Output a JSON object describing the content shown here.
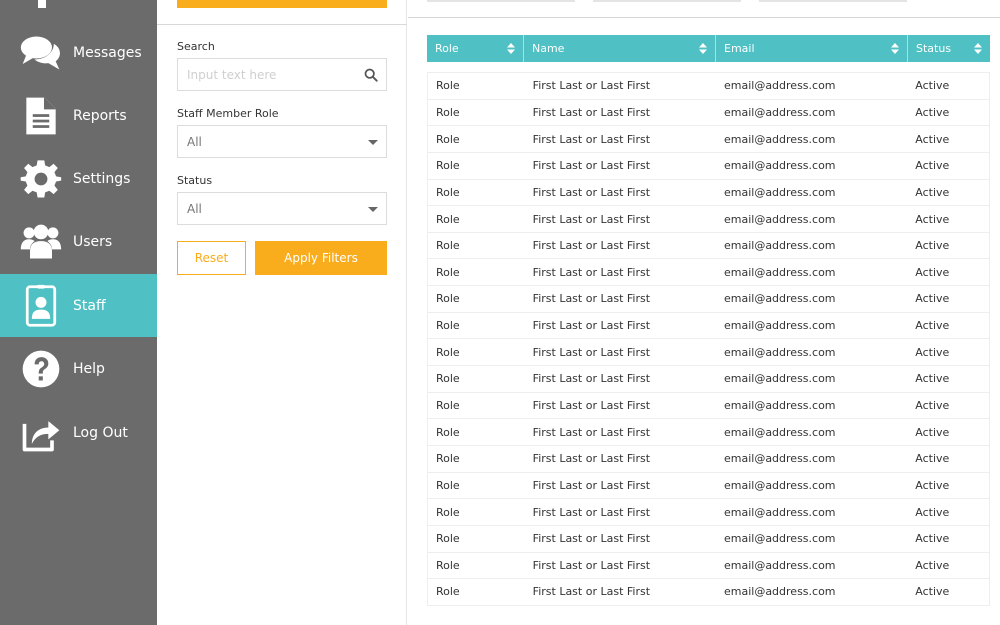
{
  "sidebar": {
    "items": [
      {
        "label": "Messages",
        "icon": "messages-icon",
        "active": false
      },
      {
        "label": "Reports",
        "icon": "document-icon",
        "active": false
      },
      {
        "label": "Settings",
        "icon": "gear-icon",
        "active": false
      },
      {
        "label": "Users",
        "icon": "users-icon",
        "active": false
      },
      {
        "label": "Staff",
        "icon": "badge-icon",
        "active": true
      },
      {
        "label": "Help",
        "icon": "help-icon",
        "active": false
      },
      {
        "label": "Log Out",
        "icon": "logout-icon",
        "active": false
      }
    ]
  },
  "filters": {
    "search_label": "Search",
    "search_placeholder": "Input text here",
    "search_value": "",
    "role_label": "Staff Member Role",
    "role_value": "All",
    "status_label": "Status",
    "status_value": "All",
    "reset_label": "Reset",
    "apply_label": "Apply Filters"
  },
  "colors": {
    "accent_teal": "#4fc0c3",
    "accent_orange": "#f9ac1c",
    "sidebar_gray": "#6b6b6b"
  },
  "table": {
    "columns": [
      "Role",
      "Name",
      "Email",
      "Status"
    ],
    "rows": [
      [
        "Role",
        "First Last or Last First",
        "email@address.com",
        "Active"
      ],
      [
        "Role",
        "First Last or Last First",
        "email@address.com",
        "Active"
      ],
      [
        "Role",
        "First Last or Last First",
        "email@address.com",
        "Active"
      ],
      [
        "Role",
        "First Last or Last First",
        "email@address.com",
        "Active"
      ],
      [
        "Role",
        "First Last or Last First",
        "email@address.com",
        "Active"
      ],
      [
        "Role",
        "First Last or Last First",
        "email@address.com",
        "Active"
      ],
      [
        "Role",
        "First Last or Last First",
        "email@address.com",
        "Active"
      ],
      [
        "Role",
        "First Last or Last First",
        "email@address.com",
        "Active"
      ],
      [
        "Role",
        "First Last or Last First",
        "email@address.com",
        "Active"
      ],
      [
        "Role",
        "First Last or Last First",
        "email@address.com",
        "Active"
      ],
      [
        "Role",
        "First Last or Last First",
        "email@address.com",
        "Active"
      ],
      [
        "Role",
        "First Last or Last First",
        "email@address.com",
        "Active"
      ],
      [
        "Role",
        "First Last or Last First",
        "email@address.com",
        "Active"
      ],
      [
        "Role",
        "First Last or Last First",
        "email@address.com",
        "Active"
      ],
      [
        "Role",
        "First Last or Last First",
        "email@address.com",
        "Active"
      ],
      [
        "Role",
        "First Last or Last First",
        "email@address.com",
        "Active"
      ],
      [
        "Role",
        "First Last or Last First",
        "email@address.com",
        "Active"
      ],
      [
        "Role",
        "First Last or Last First",
        "email@address.com",
        "Active"
      ],
      [
        "Role",
        "First Last or Last First",
        "email@address.com",
        "Active"
      ],
      [
        "Role",
        "First Last or Last First",
        "email@address.com",
        "Active"
      ]
    ]
  }
}
